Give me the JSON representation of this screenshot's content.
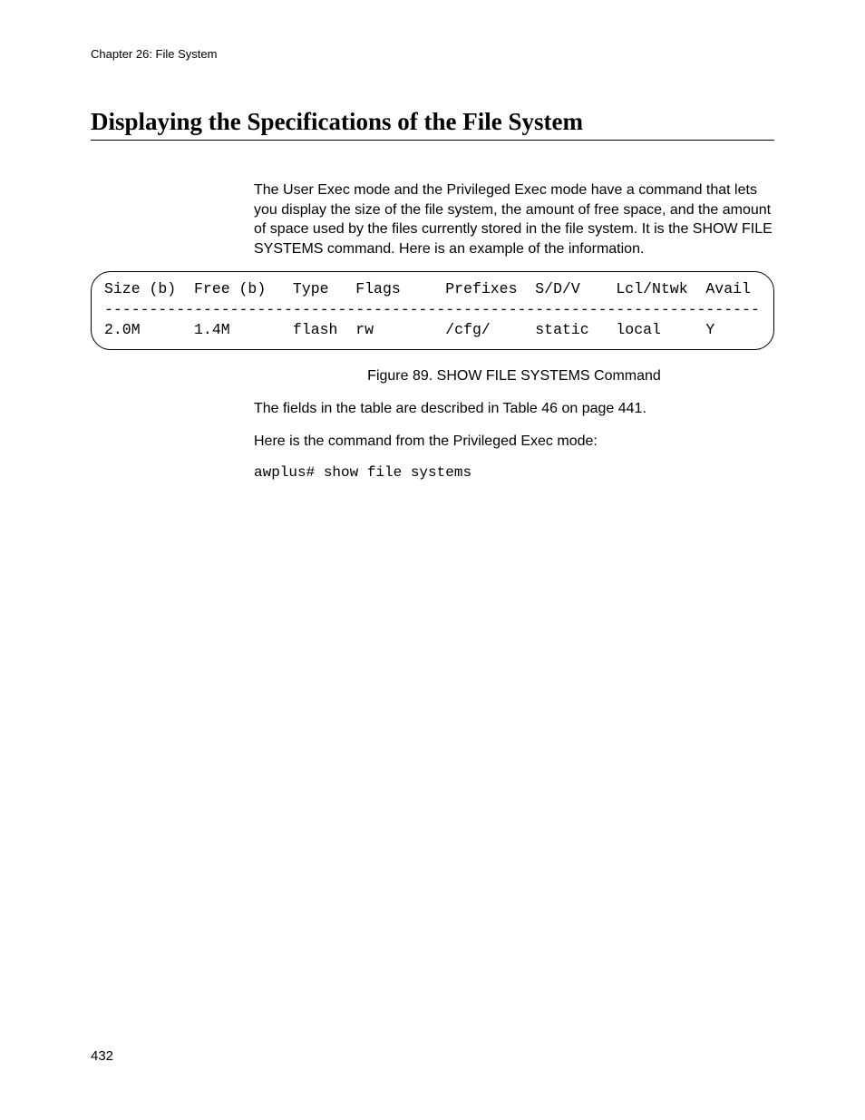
{
  "header": {
    "running": "Chapter 26: File System"
  },
  "section": {
    "title": "Displaying the Specifications of the File System"
  },
  "paragraphs": {
    "intro": "The User Exec mode and the Privileged Exec mode have a command that lets you display the size of the file system, the amount of free space, and the amount of space used by the files currently stored in the file system. It is the SHOW FILE SYSTEMS command. Here is an example of the information.",
    "fields_note": "The fields in the table are described in Table 46 on page 441.",
    "cmd_intro": "Here is the command from the Privileged Exec mode:"
  },
  "terminal": {
    "line1": "Size (b)  Free (b)   Type   Flags     Prefixes  S/D/V    Lcl/Ntwk  Avail",
    "line2": "-------------------------------------------------------------------------",
    "line3": "2.0M      1.4M       flash  rw        /cfg/     static   local     Y"
  },
  "figure": {
    "caption": "Figure 89. SHOW FILE SYSTEMS Command"
  },
  "command": {
    "text": "awplus# show file systems"
  },
  "footer": {
    "page_number": "432"
  },
  "chart_data": {
    "type": "table",
    "title": "SHOW FILE SYSTEMS output",
    "columns": [
      "Size (b)",
      "Free (b)",
      "Type",
      "Flags",
      "Prefixes",
      "S/D/V",
      "Lcl/Ntwk",
      "Avail"
    ],
    "rows": [
      [
        "2.0M",
        "1.4M",
        "flash",
        "rw",
        "/cfg/",
        "static",
        "local",
        "Y"
      ]
    ]
  }
}
